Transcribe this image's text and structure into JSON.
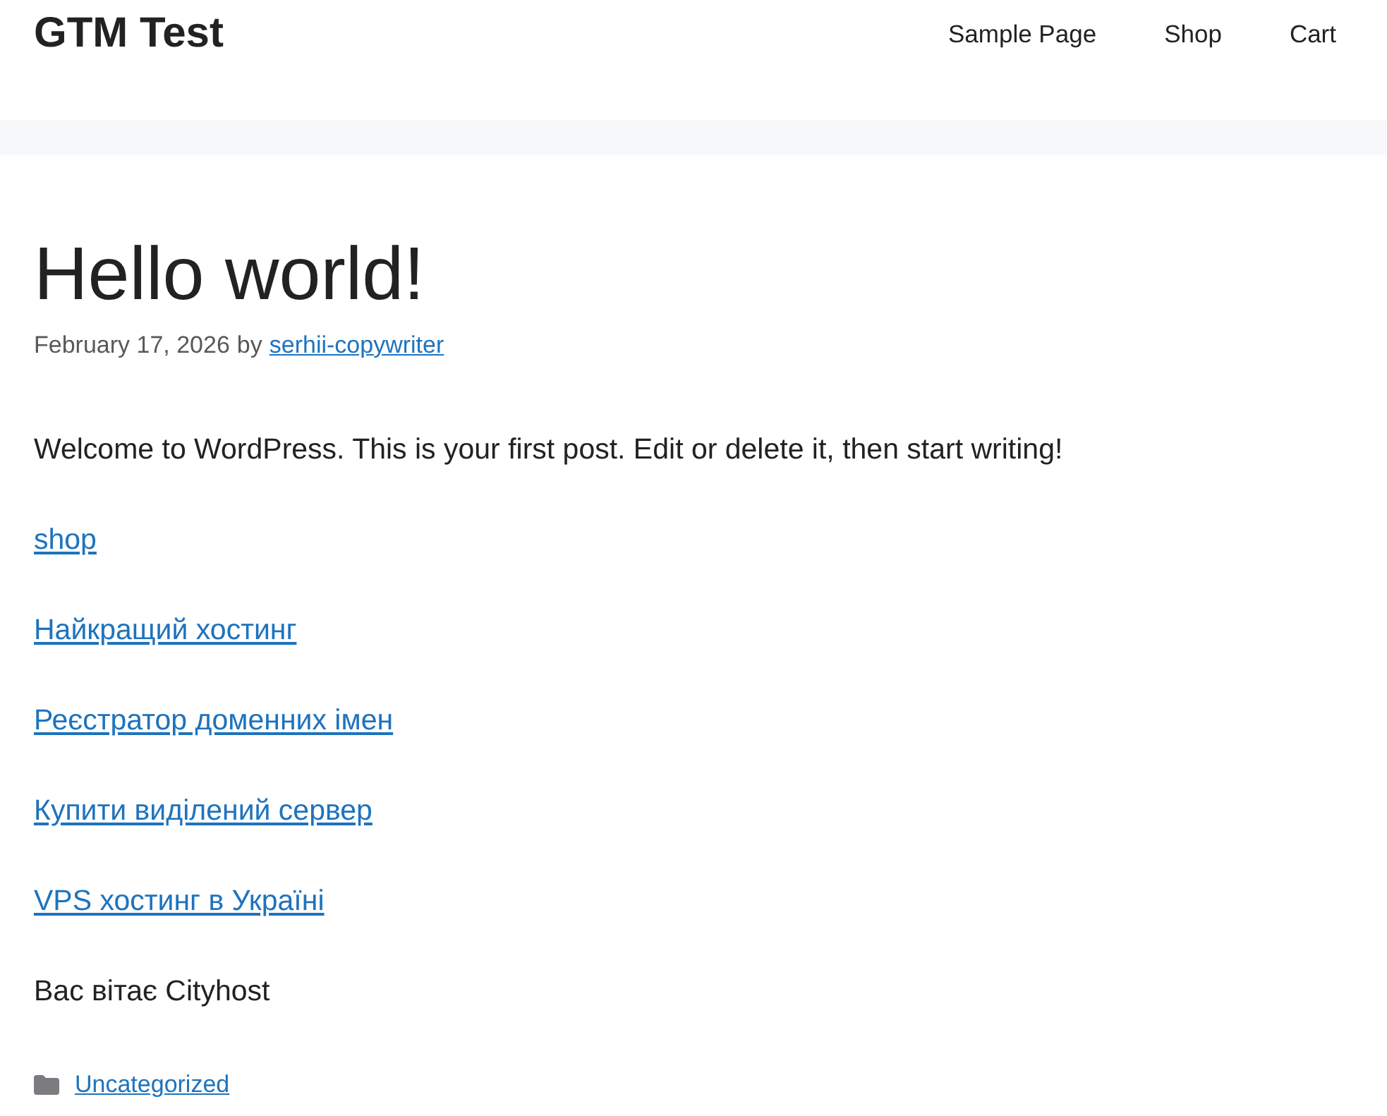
{
  "header": {
    "site_title": "GTM Test",
    "nav": [
      {
        "label": "Sample Page"
      },
      {
        "label": "Shop"
      },
      {
        "label": "Cart"
      }
    ]
  },
  "post": {
    "title": "Hello world!",
    "meta": {
      "date": "February 17, 2026",
      "by": "by",
      "author": "serhii-copywriter"
    },
    "content": [
      {
        "kind": "text",
        "text": "Welcome to WordPress. This is your first post. Edit or delete it, then start writing!"
      },
      {
        "kind": "link",
        "text": "shop"
      },
      {
        "kind": "link",
        "text": "Найкращий хостинг"
      },
      {
        "kind": "link",
        "text": "Реєстратор доменних імен"
      },
      {
        "kind": "link",
        "text": "Купити виділений сервер"
      },
      {
        "kind": "link",
        "text": "VPS хостинг в Україні"
      },
      {
        "kind": "text",
        "text": "Вас вітає Cityhost"
      }
    ],
    "category": "Uncategorized"
  }
}
